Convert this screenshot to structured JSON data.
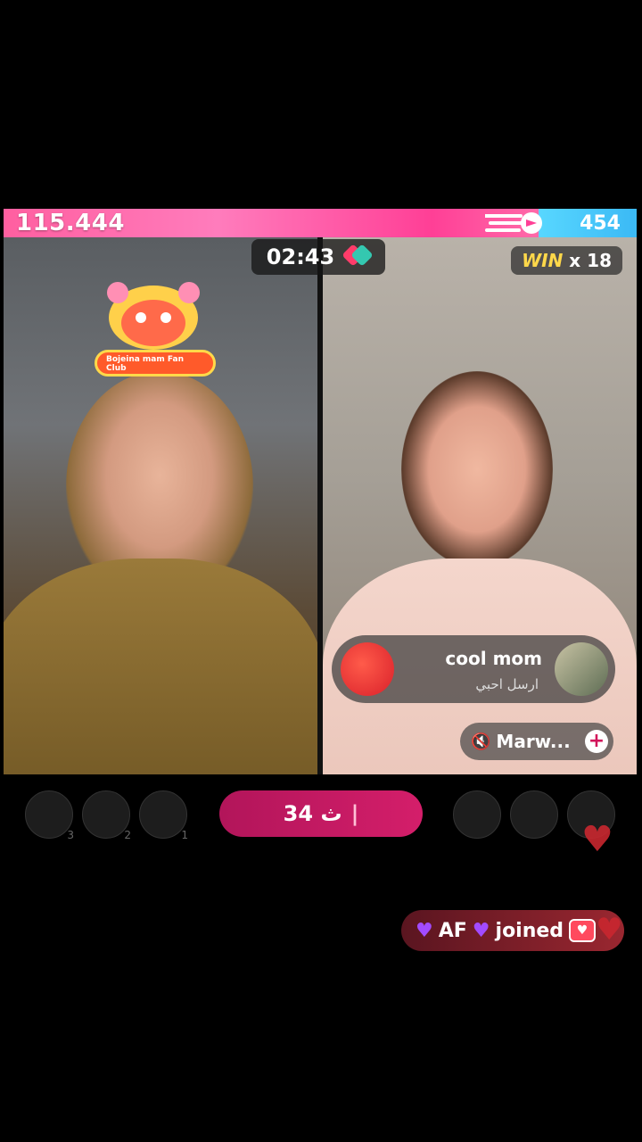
{
  "battle": {
    "left_score": "115.444",
    "right_score": "454",
    "timer": "02:43",
    "win_label": "WIN",
    "win_count": "x 18"
  },
  "left_host": {
    "fan_club_label": "Bojeina mam Fan Club"
  },
  "comment": {
    "username": "cool mom",
    "message": "ارسل احبي"
  },
  "right_host": {
    "name_tag": "Marw..."
  },
  "viewers_left": [
    {
      "rank": "3"
    },
    {
      "rank": "2"
    },
    {
      "rank": "1"
    }
  ],
  "viewers_right": [
    {
      "rank": ""
    },
    {
      "rank": ""
    },
    {
      "rank": ""
    }
  ],
  "coin_pill": {
    "value": "34 ث",
    "separator": "|"
  },
  "joined": {
    "user": "AF",
    "label": "joined"
  },
  "colors": {
    "left_team": "#ff4f9a",
    "right_team": "#3bb9f5",
    "accent": "#d41e6a"
  }
}
